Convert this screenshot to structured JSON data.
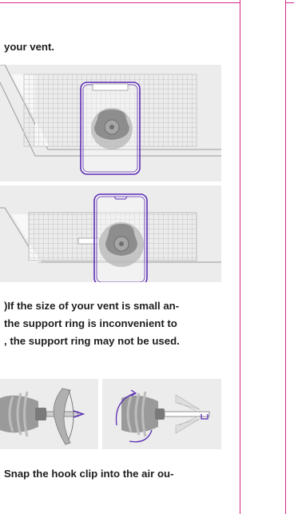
{
  "step_intro": {
    "line1": "your vent."
  },
  "note": {
    "line1": ")If the size of your vent is small an-",
    "line2": "the support ring is inconvenient to",
    "line3": ", the support ring may not be used."
  },
  "step_next": {
    "line1": "Snap the hook clip into the air ou-"
  },
  "colors": {
    "frame": "#d8288a",
    "phone_outline": "#5b2db5",
    "panel_bg": "#ececec"
  },
  "illustrations": [
    "vent-mount-vertical-illustration",
    "vent-mount-horizontal-illustration",
    "hook-clip-assembly-illustration",
    "hook-clip-rotate-illustration"
  ]
}
